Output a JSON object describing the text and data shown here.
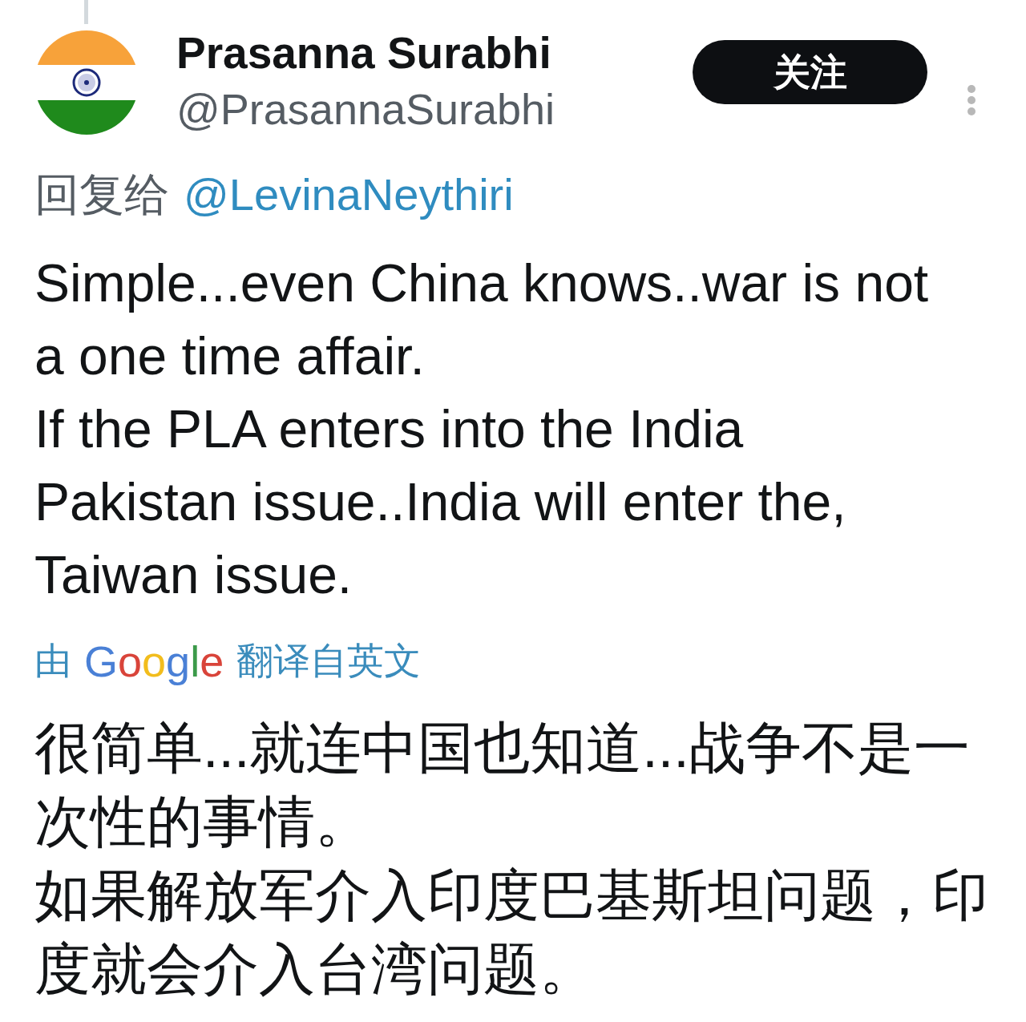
{
  "tweet": {
    "author": {
      "name": "Prasanna Surabhi",
      "handle": "@PrasannaSurabhi"
    },
    "follow_button": {
      "label": "关注"
    },
    "reply_to": {
      "prefix": "回复给",
      "handle": "@LevinaNeythiri"
    },
    "text": [
      "Simple...even China knows..war is not a one time affair.",
      "If the PLA enters into the India Pakistan issue..India will enter the, Taiwan issue."
    ],
    "translation": {
      "prefix": "由",
      "provider": "Google",
      "suffix": "翻译自英文"
    },
    "translated_text": [
      "很简单...就连中国也知道...战争不是一次性的事情。",
      "如果解放军介入印度巴基斯坦问题，印度就会介入台湾问题。"
    ]
  }
}
